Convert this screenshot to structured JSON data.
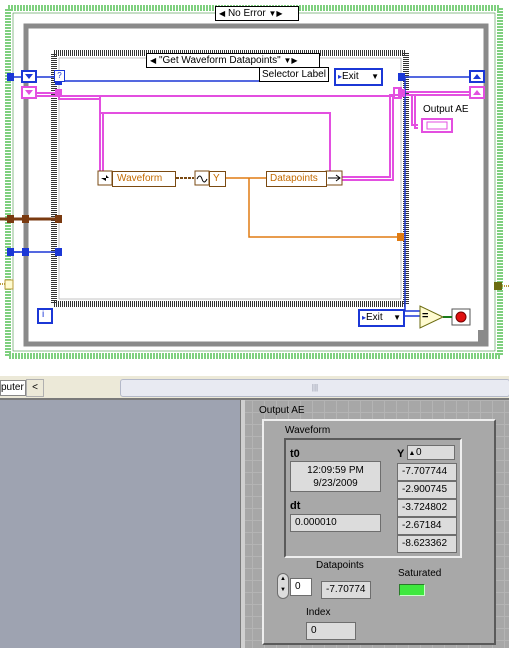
{
  "diagram": {
    "error_case_selector": "No Error",
    "case_selector": "\"Get Waveform Datapoints\"",
    "selector_label": "Selector Label",
    "exit_enum_top": "Exit",
    "exit_enum_bottom": "Exit",
    "output_ae_label": "Output AE",
    "question_mark": "?",
    "iteration_label": "i",
    "unbundle_waveform": "Waveform",
    "unbundle_y": "Y",
    "bundle_datapoints": "Datapoints",
    "equals_symbol": "=",
    "colors": {
      "error_border": "#7fd07f",
      "loop_border": "#7f7f7f",
      "case_border": "#3c3c3c",
      "pink_wire": "#e34fe0",
      "blue_wire": "#1b37d6",
      "orange_wire": "#e07b12",
      "brown_wire": "#7a3a10"
    }
  },
  "scroll": {
    "tab_label": "puter",
    "left_arrow": "<",
    "thumb_grip": "|||"
  },
  "front_panel": {
    "cluster_label": "Output AE",
    "waveform_label": "Waveform",
    "t0_label": "t0",
    "t0_time": "12:09:59 PM",
    "t0_date": "9/23/2009",
    "dt_label": "dt",
    "dt_value": "0.000010",
    "y_label": "Y",
    "y_index": "0",
    "y_values": [
      "-7.707744",
      "-2.900745",
      "-3.724802",
      "-2.67184",
      "-8.623362"
    ],
    "datapoints_label": "Datapoints",
    "datapoints_index": "0",
    "datapoints_value": "-7.70774",
    "saturated_label": "Saturated",
    "index_label": "Index",
    "index_value": "0"
  }
}
